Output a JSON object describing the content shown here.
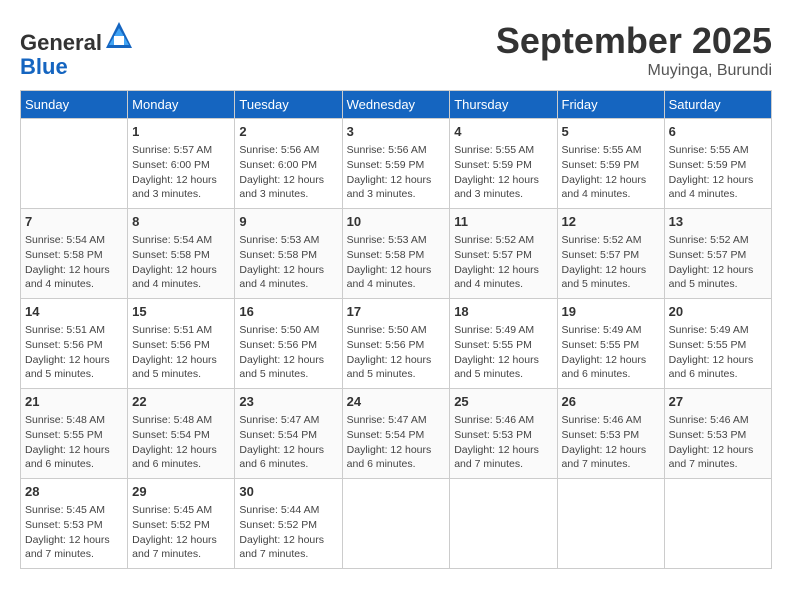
{
  "header": {
    "logo_general": "General",
    "logo_blue": "Blue",
    "month_title": "September 2025",
    "location": "Muyinga, Burundi"
  },
  "days_of_week": [
    "Sunday",
    "Monday",
    "Tuesday",
    "Wednesday",
    "Thursday",
    "Friday",
    "Saturday"
  ],
  "weeks": [
    [
      {
        "day": "",
        "sunrise": "",
        "sunset": "",
        "daylight": ""
      },
      {
        "day": "1",
        "sunrise": "Sunrise: 5:57 AM",
        "sunset": "Sunset: 6:00 PM",
        "daylight": "Daylight: 12 hours and 3 minutes."
      },
      {
        "day": "2",
        "sunrise": "Sunrise: 5:56 AM",
        "sunset": "Sunset: 6:00 PM",
        "daylight": "Daylight: 12 hours and 3 minutes."
      },
      {
        "day": "3",
        "sunrise": "Sunrise: 5:56 AM",
        "sunset": "Sunset: 5:59 PM",
        "daylight": "Daylight: 12 hours and 3 minutes."
      },
      {
        "day": "4",
        "sunrise": "Sunrise: 5:55 AM",
        "sunset": "Sunset: 5:59 PM",
        "daylight": "Daylight: 12 hours and 3 minutes."
      },
      {
        "day": "5",
        "sunrise": "Sunrise: 5:55 AM",
        "sunset": "Sunset: 5:59 PM",
        "daylight": "Daylight: 12 hours and 4 minutes."
      },
      {
        "day": "6",
        "sunrise": "Sunrise: 5:55 AM",
        "sunset": "Sunset: 5:59 PM",
        "daylight": "Daylight: 12 hours and 4 minutes."
      }
    ],
    [
      {
        "day": "7",
        "sunrise": "Sunrise: 5:54 AM",
        "sunset": "Sunset: 5:58 PM",
        "daylight": "Daylight: 12 hours and 4 minutes."
      },
      {
        "day": "8",
        "sunrise": "Sunrise: 5:54 AM",
        "sunset": "Sunset: 5:58 PM",
        "daylight": "Daylight: 12 hours and 4 minutes."
      },
      {
        "day": "9",
        "sunrise": "Sunrise: 5:53 AM",
        "sunset": "Sunset: 5:58 PM",
        "daylight": "Daylight: 12 hours and 4 minutes."
      },
      {
        "day": "10",
        "sunrise": "Sunrise: 5:53 AM",
        "sunset": "Sunset: 5:58 PM",
        "daylight": "Daylight: 12 hours and 4 minutes."
      },
      {
        "day": "11",
        "sunrise": "Sunrise: 5:52 AM",
        "sunset": "Sunset: 5:57 PM",
        "daylight": "Daylight: 12 hours and 4 minutes."
      },
      {
        "day": "12",
        "sunrise": "Sunrise: 5:52 AM",
        "sunset": "Sunset: 5:57 PM",
        "daylight": "Daylight: 12 hours and 5 minutes."
      },
      {
        "day": "13",
        "sunrise": "Sunrise: 5:52 AM",
        "sunset": "Sunset: 5:57 PM",
        "daylight": "Daylight: 12 hours and 5 minutes."
      }
    ],
    [
      {
        "day": "14",
        "sunrise": "Sunrise: 5:51 AM",
        "sunset": "Sunset: 5:56 PM",
        "daylight": "Daylight: 12 hours and 5 minutes."
      },
      {
        "day": "15",
        "sunrise": "Sunrise: 5:51 AM",
        "sunset": "Sunset: 5:56 PM",
        "daylight": "Daylight: 12 hours and 5 minutes."
      },
      {
        "day": "16",
        "sunrise": "Sunrise: 5:50 AM",
        "sunset": "Sunset: 5:56 PM",
        "daylight": "Daylight: 12 hours and 5 minutes."
      },
      {
        "day": "17",
        "sunrise": "Sunrise: 5:50 AM",
        "sunset": "Sunset: 5:56 PM",
        "daylight": "Daylight: 12 hours and 5 minutes."
      },
      {
        "day": "18",
        "sunrise": "Sunrise: 5:49 AM",
        "sunset": "Sunset: 5:55 PM",
        "daylight": "Daylight: 12 hours and 5 minutes."
      },
      {
        "day": "19",
        "sunrise": "Sunrise: 5:49 AM",
        "sunset": "Sunset: 5:55 PM",
        "daylight": "Daylight: 12 hours and 6 minutes."
      },
      {
        "day": "20",
        "sunrise": "Sunrise: 5:49 AM",
        "sunset": "Sunset: 5:55 PM",
        "daylight": "Daylight: 12 hours and 6 minutes."
      }
    ],
    [
      {
        "day": "21",
        "sunrise": "Sunrise: 5:48 AM",
        "sunset": "Sunset: 5:55 PM",
        "daylight": "Daylight: 12 hours and 6 minutes."
      },
      {
        "day": "22",
        "sunrise": "Sunrise: 5:48 AM",
        "sunset": "Sunset: 5:54 PM",
        "daylight": "Daylight: 12 hours and 6 minutes."
      },
      {
        "day": "23",
        "sunrise": "Sunrise: 5:47 AM",
        "sunset": "Sunset: 5:54 PM",
        "daylight": "Daylight: 12 hours and 6 minutes."
      },
      {
        "day": "24",
        "sunrise": "Sunrise: 5:47 AM",
        "sunset": "Sunset: 5:54 PM",
        "daylight": "Daylight: 12 hours and 6 minutes."
      },
      {
        "day": "25",
        "sunrise": "Sunrise: 5:46 AM",
        "sunset": "Sunset: 5:53 PM",
        "daylight": "Daylight: 12 hours and 7 minutes."
      },
      {
        "day": "26",
        "sunrise": "Sunrise: 5:46 AM",
        "sunset": "Sunset: 5:53 PM",
        "daylight": "Daylight: 12 hours and 7 minutes."
      },
      {
        "day": "27",
        "sunrise": "Sunrise: 5:46 AM",
        "sunset": "Sunset: 5:53 PM",
        "daylight": "Daylight: 12 hours and 7 minutes."
      }
    ],
    [
      {
        "day": "28",
        "sunrise": "Sunrise: 5:45 AM",
        "sunset": "Sunset: 5:53 PM",
        "daylight": "Daylight: 12 hours and 7 minutes."
      },
      {
        "day": "29",
        "sunrise": "Sunrise: 5:45 AM",
        "sunset": "Sunset: 5:52 PM",
        "daylight": "Daylight: 12 hours and 7 minutes."
      },
      {
        "day": "30",
        "sunrise": "Sunrise: 5:44 AM",
        "sunset": "Sunset: 5:52 PM",
        "daylight": "Daylight: 12 hours and 7 minutes."
      },
      {
        "day": "",
        "sunrise": "",
        "sunset": "",
        "daylight": ""
      },
      {
        "day": "",
        "sunrise": "",
        "sunset": "",
        "daylight": ""
      },
      {
        "day": "",
        "sunrise": "",
        "sunset": "",
        "daylight": ""
      },
      {
        "day": "",
        "sunrise": "",
        "sunset": "",
        "daylight": ""
      }
    ]
  ]
}
